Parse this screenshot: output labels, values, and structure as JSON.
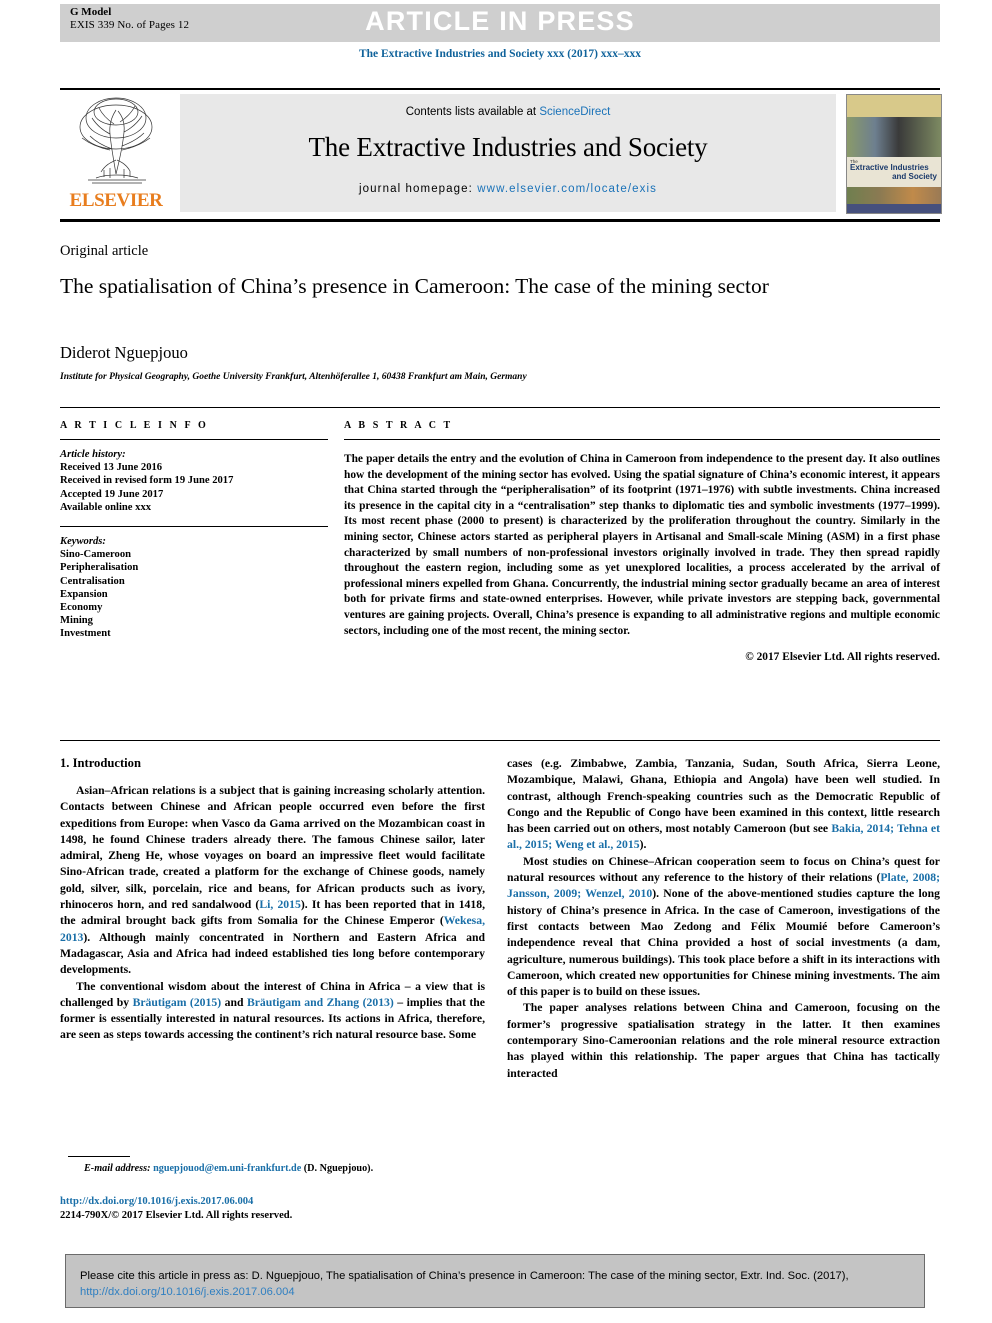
{
  "banner": {
    "g_model_label": "G Model",
    "g_model_detail": "EXIS 339 No. of Pages 12",
    "article_in_press": "ARTICLE IN PRESS"
  },
  "journal_ref": "The Extractive Industries and Society xxx (2017) xxx–xxx",
  "masthead": {
    "contents_prefix": "Contents lists available at ",
    "sciencedirect": "ScienceDirect",
    "journal_title": "The Extractive Industries and Society",
    "homepage_prefix": "journal homepage: ",
    "homepage_url": "www.elsevier.com/locate/exis",
    "publisher": "ELSEVIER",
    "cover": {
      "line1": "The",
      "line2": "Extractive Industries",
      "line3": "and Society"
    }
  },
  "article": {
    "type": "Original article",
    "title": "The spatialisation of China’s presence in Cameroon: The case of the mining sector",
    "author": "Diderot Nguepjouo",
    "affiliation": "Institute for Physical Geography, Goethe University Frankfurt, Altenhöferallee 1, 60438 Frankfurt am Main, Germany"
  },
  "info": {
    "heading": "A R T I C L E   I N F O",
    "history_label": "Article history:",
    "history": [
      "Received 13 June 2016",
      "Received in revised form 19 June 2017",
      "Accepted 19 June 2017",
      "Available online xxx"
    ],
    "keywords_label": "Keywords:",
    "keywords": [
      "Sino-Cameroon",
      "Peripheralisation",
      "Centralisation",
      "Expansion",
      "Economy",
      "Mining",
      "Investment"
    ]
  },
  "abstract": {
    "heading": "A B S T R A C T",
    "text": "The paper details the entry and the evolution of China in Cameroon from independence to the present day. It also outlines how the development of the mining sector has evolved. Using the spatial signature of China’s economic interest, it appears that China started through the “peripheralisation” of its footprint (1971–1976) with subtle investments. China increased its presence in the capital city in a “centralisation” step thanks to diplomatic ties and symbolic investments (1977–1999). Its most recent phase (2000 to present) is characterized by the proliferation throughout the country. Similarly in the mining sector, Chinese actors started as peripheral players in Artisanal and Small-scale Mining (ASM) in a first phase characterized by small numbers of non-professional investors originally involved in trade. They then spread rapidly throughout the eastern region, including some as yet unexplored localities, a process accelerated by the arrival of professional miners expelled from Ghana. Concurrently, the industrial mining sector gradually became an area of interest both for private firms and state-owned enterprises. However, while private investors are stepping back, governmental ventures are gaining projects. Overall, China’s presence is expanding to all administrative regions and multiple economic sectors, including one of the most recent, the mining sector.",
    "copyright": "© 2017 Elsevier Ltd. All rights reserved."
  },
  "body": {
    "section_title": "1. Introduction",
    "left_paragraphs": [
      {
        "parts": [
          {
            "t": "Asian–African relations is a subject that is gaining increasing scholarly attention. Contacts between Chinese and African people occurred even before the first expeditions from Europe: when Vasco da Gama arrived on the Mozambican coast in 1498, he found Chinese traders already there. The famous Chinese sailor, later admiral, Zheng He, whose voyages on board an impressive fleet would facilitate Sino-African trade, created a platform for the exchange of Chinese goods, namely gold, silver, silk, porcelain, rice and beans, for African products such as ivory, rhinoceros horn, and red sandalwood ("
          },
          {
            "t": "Li, 2015",
            "link": true
          },
          {
            "t": "). It has been reported that in 1418, the admiral brought back gifts from Somalia for the Chinese Emperor ("
          },
          {
            "t": "Wekesa, 2013",
            "link": true
          },
          {
            "t": "). Although mainly concentrated in Northern and Eastern Africa and Madagascar, Asia and Africa had indeed established ties long before contemporary developments."
          }
        ]
      },
      {
        "parts": [
          {
            "t": "The conventional wisdom about the interest of China in Africa – a view that is challenged by "
          },
          {
            "t": "Bräutigam (2015)",
            "link": true
          },
          {
            "t": " and "
          },
          {
            "t": "Bräutigam and Zhang (2013)",
            "link": true
          },
          {
            "t": " – implies that the former is essentially interested in natural resources. Its actions in Africa, therefore, are seen as steps towards accessing the continent’s rich natural resource base. Some"
          }
        ]
      }
    ],
    "right_paragraphs": [
      {
        "parts": [
          {
            "t": "cases (e.g. Zimbabwe, Zambia, Tanzania, Sudan, South Africa, Sierra Leone, Mozambique, Malawi, Ghana, Ethiopia and Angola) have been well studied. In contrast, although French-speaking countries such as the Democratic Republic of Congo and the Republic of Congo have been examined in this context, little research has been carried out on others, most notably Cameroon (but see "
          },
          {
            "t": "Bakia, 2014; Tehna et al., 2015; Weng et al., 2015",
            "link": true
          },
          {
            "t": ")."
          }
        ],
        "no_indent": true
      },
      {
        "parts": [
          {
            "t": "Most studies on Chinese–African cooperation seem to focus on China’s quest for natural resources without any reference to the history of their relations ("
          },
          {
            "t": "Plate, 2008; Jansson, 2009; Wenzel, 2010",
            "link": true
          },
          {
            "t": "). None of the above-mentioned studies capture the long history of China’s presence in Africa. In the case of Cameroon, investigations of the first contacts between Mao Zedong and Félix Moumié before Cameroon’s independence reveal that China provided a host of social investments (a dam, agriculture, numerous buildings). This took place before a shift in its interactions with Cameroon, which created new opportunities for Chinese mining investments. The aim of this paper is to build on these issues."
          }
        ]
      },
      {
        "parts": [
          {
            "t": "The paper analyses relations between China and Cameroon, focusing on the former’s progressive spatialisation strategy in the latter. It then examines contemporary Sino-Cameroonian relations and the role mineral resource extraction has played within this relationship. The paper argues that China has tactically interacted"
          }
        ]
      }
    ]
  },
  "footer": {
    "email_label": "E-mail address:",
    "email": "nguepjouod@em.uni-frankfurt.de",
    "email_suffix": " (D. Nguepjouo).",
    "doi": "http://dx.doi.org/10.1016/j.exis.2017.06.004",
    "issn": "2214-790X/© 2017 Elsevier Ltd. All rights reserved."
  },
  "cite_box": {
    "prefix": "Please cite this article in press as: D. Nguepjouo, The spatialisation of China’s presence in Cameroon: The case of the mining sector, Extr. Ind. Soc. (2017), ",
    "link": "http://dx.doi.org/10.1016/j.exis.2017.06.004"
  },
  "colors": {
    "banner_gray": "#cfcfcf",
    "link_blue": "#1a6fa8",
    "elsevier_orange": "#e87d1e",
    "masthead_gray": "#e8e8e8",
    "cite_box_gray": "#c4c4c4"
  }
}
